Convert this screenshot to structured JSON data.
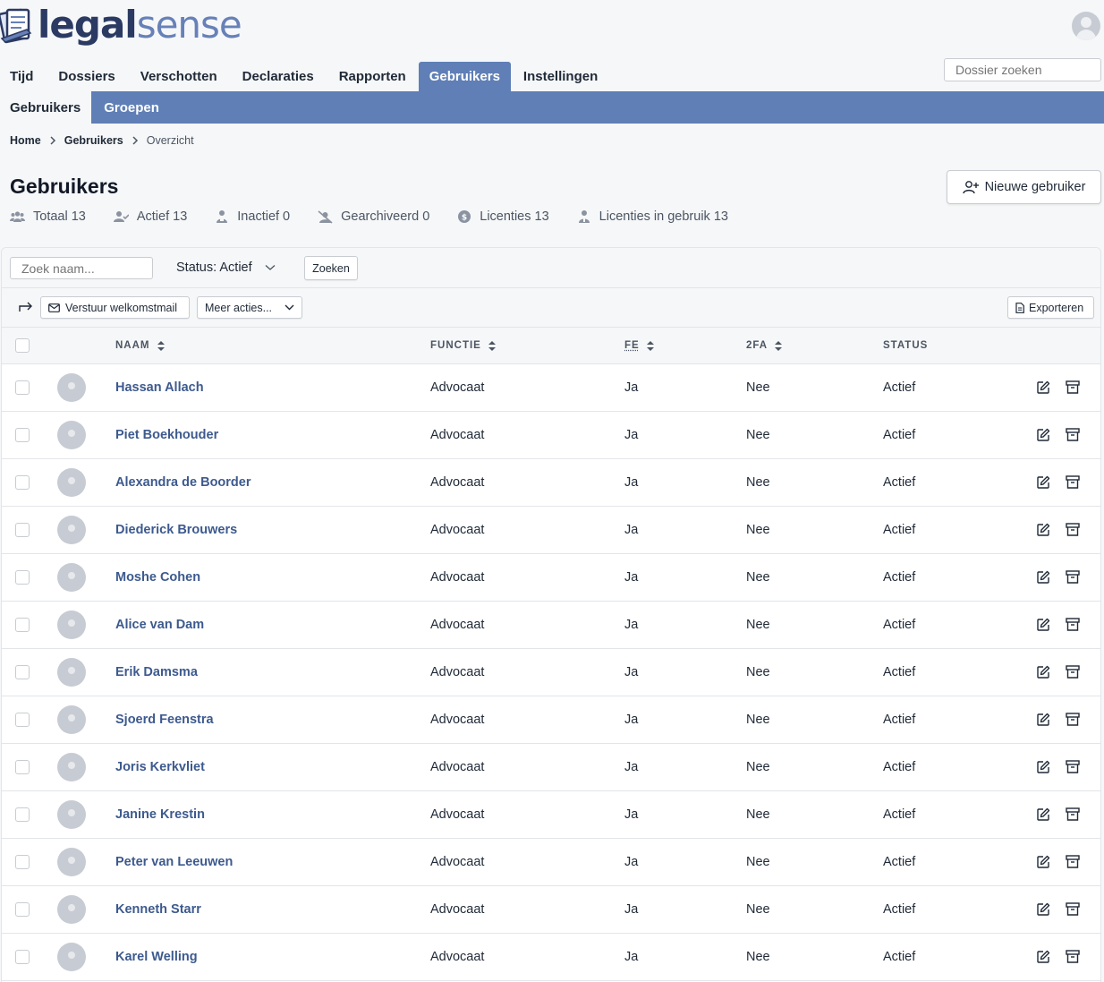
{
  "app": {
    "logo_bold": "legal",
    "logo_light": "sense",
    "accent": "#5f7fb6"
  },
  "main_nav": [
    "Tijd",
    "Dossiers",
    "Verschotten",
    "Declaraties",
    "Rapporten",
    "Gebruikers",
    "Instellingen"
  ],
  "main_nav_active": "Gebruikers",
  "dossier_search": {
    "placeholder": "Dossier zoeken"
  },
  "sub_nav": [
    "Gebruikers",
    "Groepen"
  ],
  "sub_nav_active": "Gebruikers",
  "breadcrumb": [
    "Home",
    "Gebruikers",
    "Overzicht"
  ],
  "page": {
    "title": "Gebruikers",
    "new_user_label": "Nieuwe gebruiker"
  },
  "stats": [
    {
      "icon": "users-icon",
      "label": "Totaal 13"
    },
    {
      "icon": "user-check-icon",
      "label": "Actief 13"
    },
    {
      "icon": "user-inactive-icon",
      "label": "Inactief 0"
    },
    {
      "icon": "user-archived-icon",
      "label": "Gearchiveerd 0"
    },
    {
      "icon": "license-icon",
      "label": "Licenties 13"
    },
    {
      "icon": "user-license-icon",
      "label": "Licenties in gebruik 13"
    }
  ],
  "filters": {
    "name_placeholder": "Zoek naam...",
    "status_label": "Status: Actief",
    "search_button": "Zoeken"
  },
  "actions": {
    "welcome_mail": "Verstuur welkomstmail",
    "more_actions": "Meer acties...",
    "export": "Exporteren"
  },
  "table": {
    "columns": {
      "naam": "NAAM",
      "functie": "FUNCTIE",
      "fe": "FE",
      "tfa": "2FA",
      "status": "STATUS"
    },
    "rows": [
      {
        "naam": "Hassan Allach",
        "functie": "Advocaat",
        "fe": "Ja",
        "tfa": "Nee",
        "status": "Actief"
      },
      {
        "naam": "Piet Boekhouder",
        "functie": "Advocaat",
        "fe": "Ja",
        "tfa": "Nee",
        "status": "Actief"
      },
      {
        "naam": "Alexandra de Boorder",
        "functie": "Advocaat",
        "fe": "Ja",
        "tfa": "Nee",
        "status": "Actief"
      },
      {
        "naam": "Diederick Brouwers",
        "functie": "Advocaat",
        "fe": "Ja",
        "tfa": "Nee",
        "status": "Actief"
      },
      {
        "naam": "Moshe Cohen",
        "functie": "Advocaat",
        "fe": "Ja",
        "tfa": "Nee",
        "status": "Actief"
      },
      {
        "naam": "Alice van Dam",
        "functie": "Advocaat",
        "fe": "Ja",
        "tfa": "Nee",
        "status": "Actief"
      },
      {
        "naam": "Erik Damsma",
        "functie": "Advocaat",
        "fe": "Ja",
        "tfa": "Nee",
        "status": "Actief"
      },
      {
        "naam": "Sjoerd Feenstra",
        "functie": "Advocaat",
        "fe": "Ja",
        "tfa": "Nee",
        "status": "Actief"
      },
      {
        "naam": "Joris Kerkvliet",
        "functie": "Advocaat",
        "fe": "Ja",
        "tfa": "Nee",
        "status": "Actief"
      },
      {
        "naam": "Janine Krestin",
        "functie": "Advocaat",
        "fe": "Ja",
        "tfa": "Nee",
        "status": "Actief"
      },
      {
        "naam": "Peter van Leeuwen",
        "functie": "Advocaat",
        "fe": "Ja",
        "tfa": "Nee",
        "status": "Actief"
      },
      {
        "naam": "Kenneth Starr",
        "functie": "Advocaat",
        "fe": "Ja",
        "tfa": "Nee",
        "status": "Actief"
      },
      {
        "naam": "Karel Welling",
        "functie": "Advocaat",
        "fe": "Ja",
        "tfa": "Nee",
        "status": "Actief"
      }
    ]
  }
}
